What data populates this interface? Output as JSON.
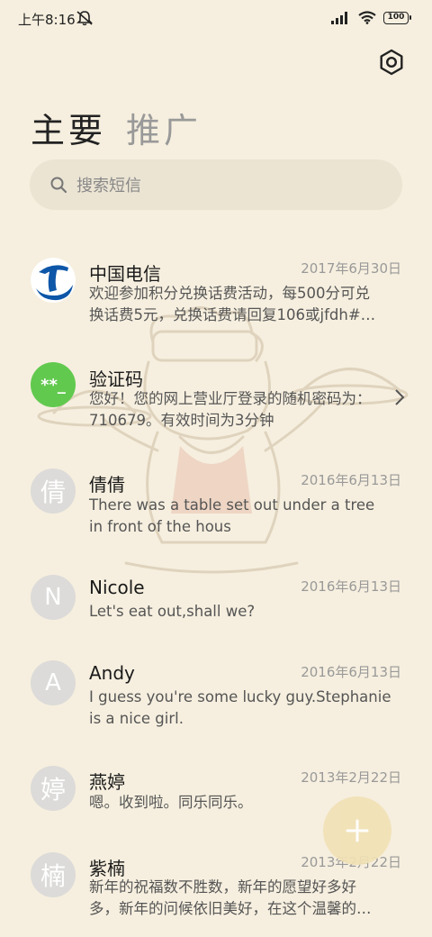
{
  "status_bar": {
    "time": "上午8:16",
    "battery": "100"
  },
  "tabs": [
    {
      "label": "主要",
      "active": true
    },
    {
      "label": "推广",
      "active": false
    }
  ],
  "search": {
    "placeholder": "搜索短信"
  },
  "conversations": [
    {
      "name": "中国电信",
      "date": "2017年6月30日",
      "message_line1": "欢迎参加积分兑换话费活动，每500分可兑",
      "message_line2": "换话费5元，兑换话费请回复106或jfdh#…",
      "avatar": "china-telecom-logo"
    },
    {
      "name": "验证码",
      "date": "",
      "message_line1": "您好！您的网上营业厅登录的随机密码为：",
      "message_line2": "710679。有效时间为3分钟",
      "avatar_text": "**_",
      "avatar_color": "#62c94f"
    },
    {
      "name": "倩倩",
      "date": "2016年6月13日",
      "message_line1": "There was a table set out under a tree",
      "message_line2": "in front of the hous",
      "avatar_text": "倩"
    },
    {
      "name": "Nicole",
      "date": "2016年6月13日",
      "message_line1": "Let's eat out,shall we?",
      "message_line2": "",
      "avatar_text": "N"
    },
    {
      "name": "Andy",
      "date": "2016年6月13日",
      "message_line1": "I guess you're some lucky guy.Stephanie",
      "message_line2": "is a nice girl.",
      "avatar_text": "A"
    },
    {
      "name": "燕婷",
      "date": "2013年2月22日",
      "message_line1": "嗯。收到啦。同乐同乐。",
      "message_line2": "",
      "avatar_text": "婷"
    },
    {
      "name": "紫楠",
      "date": "2013年2月22日",
      "message_line1": "新年的祝福数不胜数，新年的愿望好多好",
      "message_line2": "多，新年的问候依旧美好，在这个温馨的…",
      "avatar_text": "楠"
    }
  ],
  "icons": {
    "settings": "gear-icon",
    "search": "search-icon",
    "compose": "plus-icon",
    "mute": "bell-off-icon"
  },
  "colors": {
    "background": "#f6efdf",
    "search_bg": "#ebe4d3",
    "verify_avatar": "#62c94f",
    "telecom_blue": "#0d56a8",
    "fab": "#f1e1b5"
  }
}
